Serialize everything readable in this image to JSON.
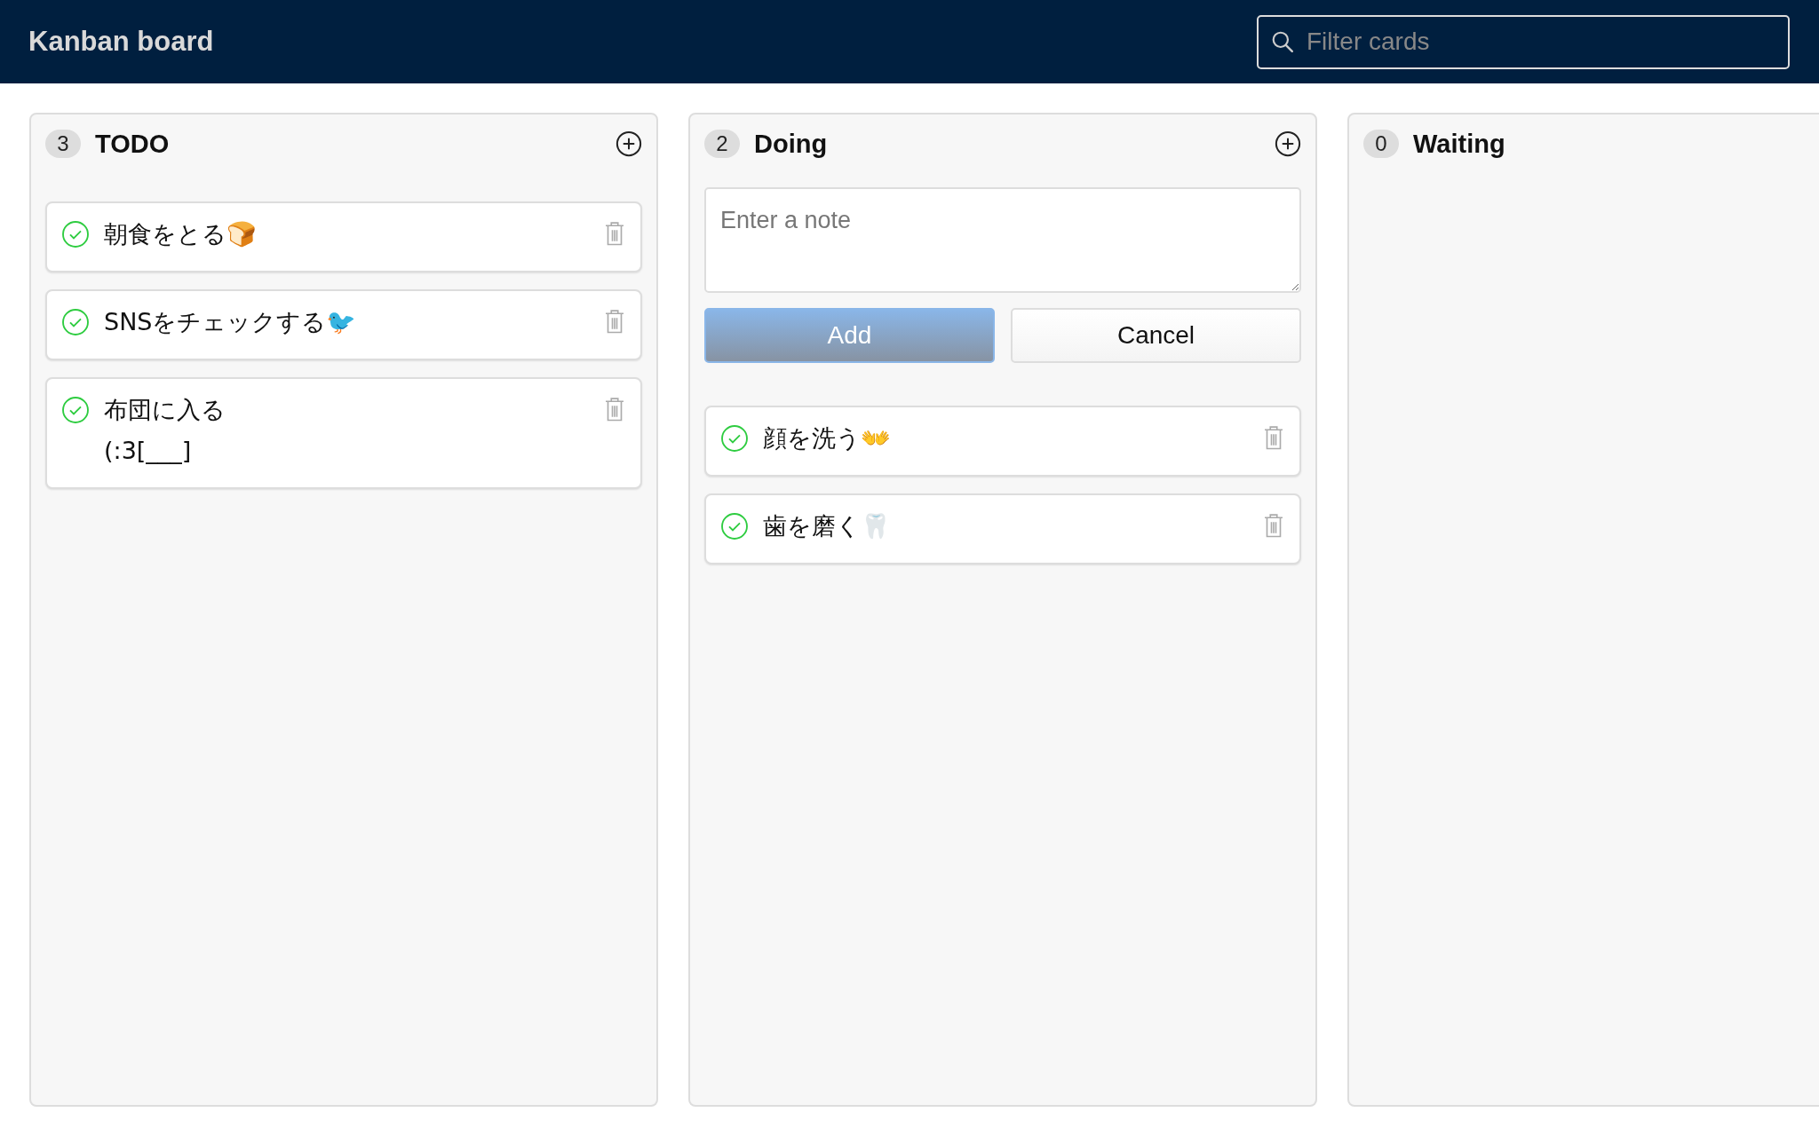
{
  "header": {
    "title": "Kanban board",
    "search": {
      "placeholder": "Filter cards"
    }
  },
  "columns": [
    {
      "title": "TODO",
      "count": "3",
      "add_button": true,
      "cards": [
        {
          "text": "朝食をとる🍞"
        },
        {
          "text": "SNSをチェックする🐦"
        },
        {
          "text": "布団に入る\n(:3[___]"
        }
      ]
    },
    {
      "title": "Doing",
      "count": "2",
      "add_button": true,
      "form": {
        "placeholder": "Enter a note",
        "submit": "Add",
        "cancel": "Cancel"
      },
      "cards": [
        {
          "text": "顔を洗う👐"
        },
        {
          "text": "歯を磨く🦷"
        }
      ]
    },
    {
      "title": "Waiting",
      "count": "0",
      "add_button": false
    }
  ]
}
